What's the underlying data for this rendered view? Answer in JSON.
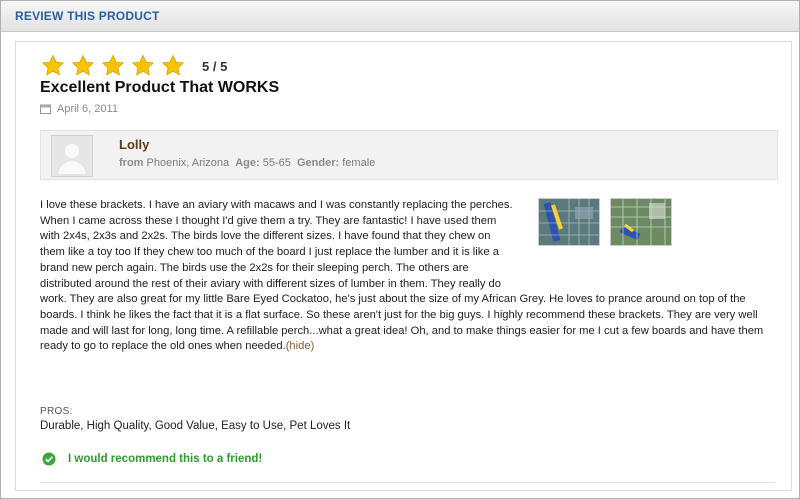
{
  "header": {
    "title": "REVIEW THIS PRODUCT"
  },
  "review": {
    "rating": {
      "value": 5,
      "max": 5,
      "text": "5 / 5",
      "star_color": "#f7c300"
    },
    "title": "Excellent Product That WORKS",
    "date": "April 6, 2011",
    "reviewer": {
      "name": "Lolly",
      "from_label": "from",
      "location": "Phoenix, Arizona",
      "age_label": "Age:",
      "age": "55-65",
      "gender_label": "Gender:",
      "gender": "female"
    },
    "body": "I love these brackets. I have an aviary with macaws and I was constantly replacing the perches. When I came across these I thought I'd give them a try. They are fantastic! I have used them with 2x4s, 2x3s and 2x2s. The birds love the different sizes. I have found that they chew on them like a toy too If they chew too much of the board I just replace the lumber and it is like a brand new perch again. The birds use the 2x2s for their sleeping perch. The others are distributed around the rest of their aviary with different sizes of lumber in them. They really do work. They are also great for my little Bare Eyed Cockatoo, he's just about the size of my African Grey. He loves to prance around on top of the boards. I think he likes the fact that it is a flat surface. So these aren't just for the big guys. I highly recommend these brackets. They are very well made and will last for long, long time. A refillable perch...what a great idea! Oh, and to make things easier for me I cut a few boards and have them ready to go to replace the old ones when needed.",
    "hide_link": "(hide)",
    "pros_label": "PROS:",
    "pros": "Durable, High Quality, Good Value, Easy to Use, Pet Loves It",
    "recommend": "I would recommend this to a friend!",
    "colors": {
      "accent_blue": "#2b5fa5",
      "recommend_green": "#2f9b2f"
    }
  }
}
